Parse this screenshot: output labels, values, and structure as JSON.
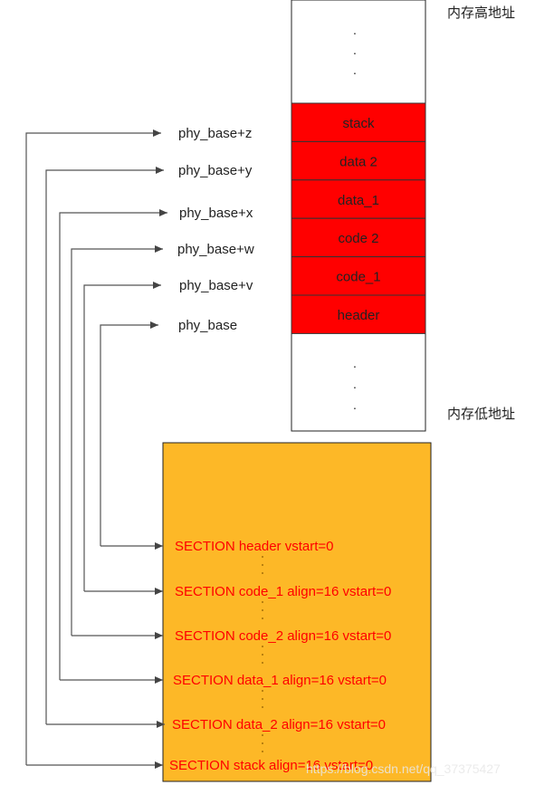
{
  "memory": {
    "high_label": "内存高地址",
    "low_label": "内存低地址",
    "ellipsis": ".",
    "segments": [
      "stack",
      "data  2",
      "data_1",
      "code  2",
      "code_1",
      "header"
    ],
    "segment_color": "#ff0000"
  },
  "addresses": [
    "phy_base+z",
    "phy_base+y",
    "phy_base+x",
    "phy_base+w",
    "phy_base+v",
    "phy_base"
  ],
  "sections": {
    "box_color": "#fdb827",
    "text_color": "#ff0000",
    "items": [
      "SECTION header  vstart=0",
      "SECTION code_1 align=16  vstart=0",
      "SECTION code_2 align=16  vstart=0",
      "SECTION data_1 align=16  vstart=0",
      "SECTION data_2 align=16  vstart=0",
      "SECTION stack align=16  vstart=0"
    ]
  },
  "watermark": "https://blog.csdn.net/qq_37375427"
}
